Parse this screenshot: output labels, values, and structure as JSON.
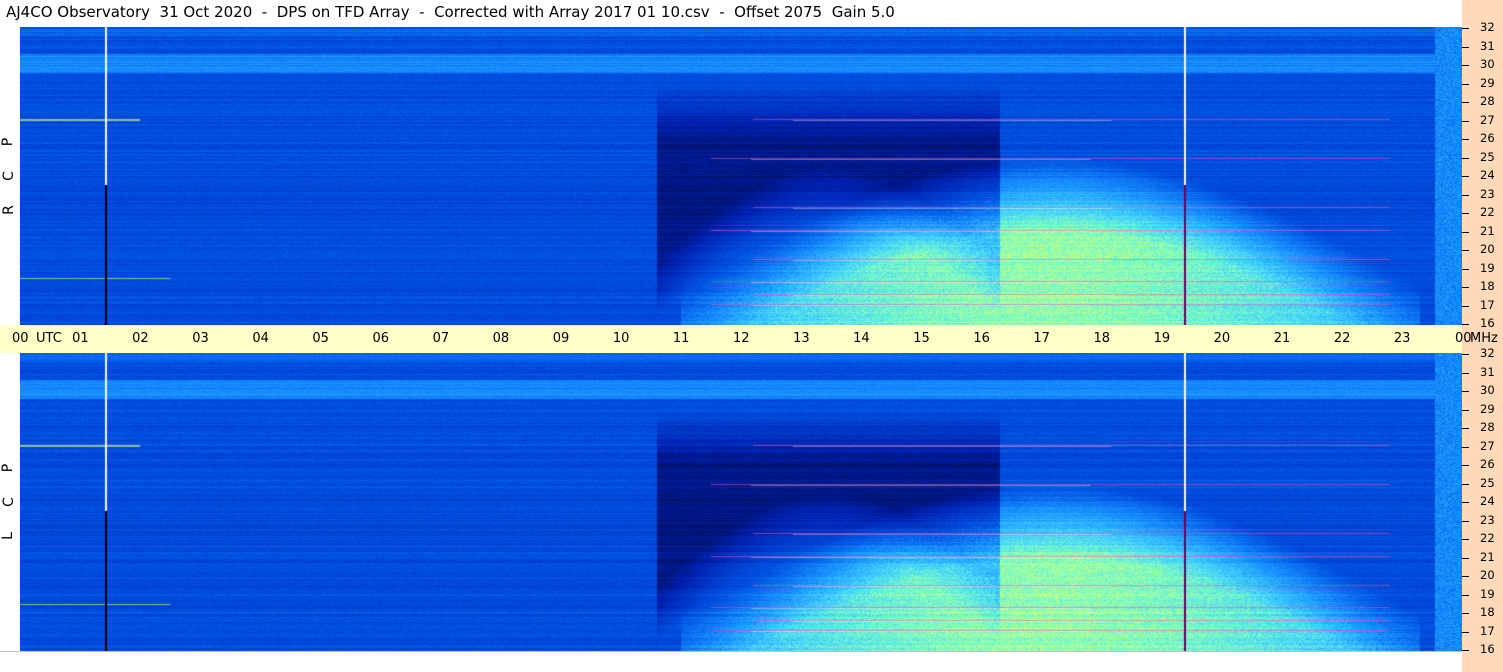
{
  "title": "AJ4CO Observatory  31 Oct 2020  -  DPS on TFD Array  -  Corrected with Array 2017 01 10.csv  -  Offset 2075  Gain 5.0",
  "chart_data": [
    {
      "type": "heatmap",
      "panel": "RCP",
      "label_letters": [
        "R",
        "C",
        "P"
      ],
      "x_unit": "UTC",
      "x_ticks": [
        "00",
        "01",
        "02",
        "03",
        "04",
        "05",
        "06",
        "07",
        "08",
        "09",
        "10",
        "11",
        "12",
        "13",
        "14",
        "15",
        "16",
        "17",
        "18",
        "19",
        "20",
        "21",
        "22",
        "23",
        "00"
      ],
      "x_range_hours": [
        0,
        24
      ],
      "y_unit": "MHz",
      "y_ticks": [
        "16",
        "17",
        "18",
        "19",
        "20",
        "21",
        "22",
        "23",
        "24",
        "25",
        "26",
        "27",
        "28",
        "29",
        "30",
        "31",
        "32"
      ],
      "y_range_mhz": [
        16,
        32
      ],
      "colormap": [
        "#000a40",
        "#0020b0",
        "#0050e0",
        "#1890ff",
        "#40d0ff",
        "#80ffc0",
        "#ffff40",
        "#ff40a0",
        "#ffffff"
      ],
      "dark_region_hours": [
        10.6,
        16.3
      ],
      "enhanced_region_hours": [
        11.0,
        23.3
      ],
      "vertical_markers_hours": [
        1.42,
        19.37
      ]
    },
    {
      "type": "heatmap",
      "panel": "LCP",
      "label_letters": [
        "L",
        "C",
        "P"
      ],
      "x_unit": "UTC",
      "x_range_hours": [
        0,
        24
      ],
      "y_unit": "MHz",
      "y_range_mhz": [
        16,
        32
      ],
      "dark_region_hours": [
        10.6,
        16.3
      ],
      "enhanced_region_hours": [
        11.0,
        23.3
      ],
      "vertical_markers_hours": [
        1.42,
        19.37
      ]
    }
  ],
  "axis": {
    "utc_label": "UTC",
    "mhz_label": "MHz"
  }
}
